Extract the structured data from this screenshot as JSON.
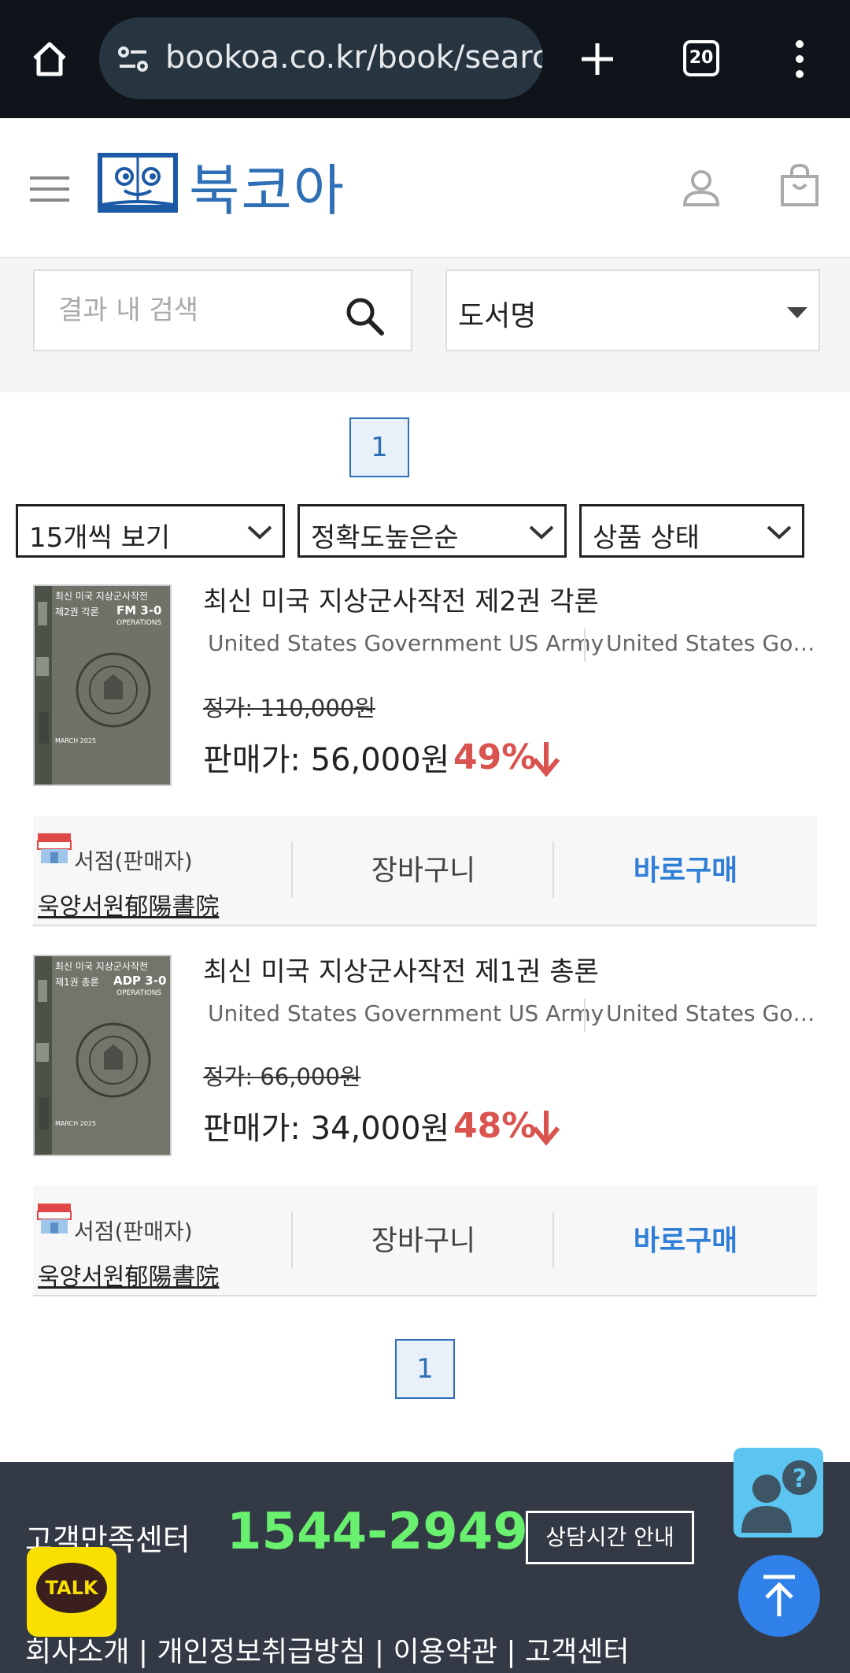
{
  "browser": {
    "url": "bookoa.co.kr/book/search",
    "tab_count": "20"
  },
  "header": {
    "logo_text": "북코아"
  },
  "search": {
    "placeholder": "결과 내 검색",
    "field_select": "도서명"
  },
  "pagination": {
    "current_page": "1"
  },
  "filters": {
    "per_page": "15개씩 보기",
    "sort": "정확도높은순",
    "condition": "상품 상태"
  },
  "products": [
    {
      "title": "최신 미국 지상군사작전 제2권 각론",
      "author": "United States Government US Army",
      "publisher": "United States Government US Army",
      "list_price": "정가: 110,000원",
      "sale_price": "판매가: 56,000원",
      "discount": "49%",
      "seller_label": "서점(판매자)",
      "seller_name": "욱양서원郁陽書院",
      "cart_label": "장바구니",
      "buy_label": "바로구매",
      "cover": {
        "line1": "최신 미국 지상군사작전",
        "line2": "제2권 각론",
        "code": "FM 3-0",
        "sub": "OPERATIONS",
        "date": "MARCH 2025"
      }
    },
    {
      "title": "최신 미국 지상군사작전 제1권 총론",
      "author": "United States Government US Army",
      "publisher": "United States Government US Army",
      "list_price": "정가: 66,000원",
      "sale_price": "판매가: 34,000원",
      "discount": "48%",
      "seller_label": "서점(판매자)",
      "seller_name": "욱양서원郁陽書院",
      "cart_label": "장바구니",
      "buy_label": "바로구매",
      "cover": {
        "line1": "최신 미국 지상군사작전",
        "line2": "제1권 총론",
        "code": "ADP 3-0",
        "sub": "OPERATIONS",
        "date": "MARCH 2025"
      }
    }
  ],
  "footer": {
    "cs_label": "고객만족센터",
    "cs_phone": "1544-2949",
    "hours_button": "상담시간 안내",
    "links": "회사소개 | 개인정보취급방침 | 이용약관 | 고객센터"
  },
  "floating": {
    "kakao_label": "TALK"
  },
  "colors": {
    "brand_blue": "#2f6fb5",
    "discount_red": "#d9534f",
    "buy_blue": "#2f7fd8",
    "footer_bg": "#333a45",
    "phone_green": "#69f06e"
  }
}
